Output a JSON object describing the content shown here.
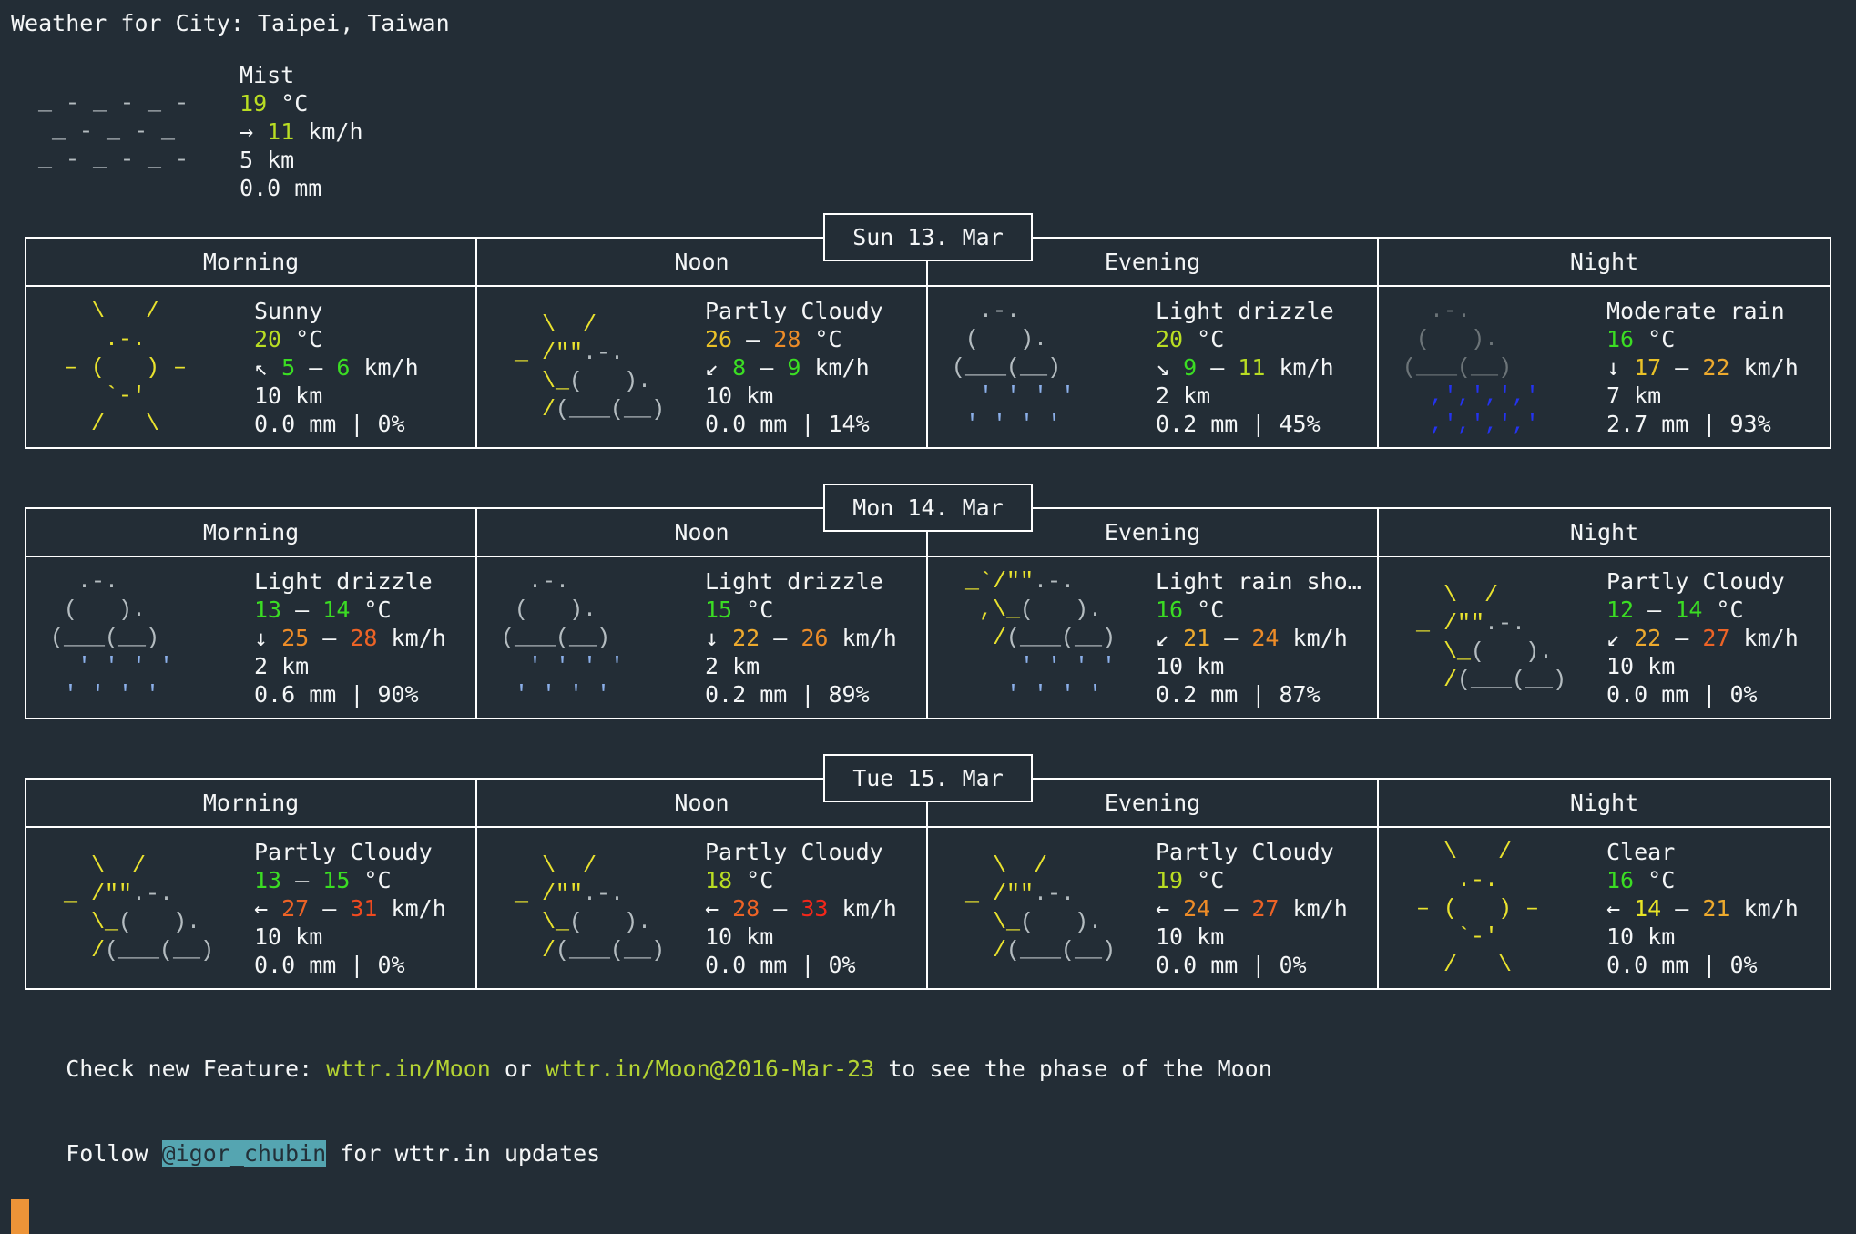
{
  "palette": {
    "w": "#f4f6f7",
    "grn": "#3bdd23",
    "ygr": "#b9dd23",
    "yel": "#e8e426",
    "gld": "#eac228",
    "org": "#edaa2e",
    "or2": "#ed8c28",
    "dor": "#ed6326",
    "ror": "#ef4a20",
    "red": "#f2271a",
    "gray": "#b4bcc0",
    "dgray": "#6c7478",
    "lblu": "#8cb0ea",
    "blu": "#2433f0",
    "sun": "#e9e22e",
    "lnk": "#b4d333",
    "hl_bg": "#55a5b1",
    "hl_fg": "#233038",
    "cursor": "#ed9438",
    "background": "#232d36",
    "border": "#ffffff"
  },
  "icons": {
    "mist": [
      [
        [
          "gray",
          "_ - _ - _ -"
        ]
      ],
      [
        [
          "gray",
          " _ - _ - _"
        ]
      ],
      [
        [
          "gray",
          "_ - _ - _ -"
        ]
      ]
    ],
    "sunny": [
      [
        [
          "sun",
          "   \\   /"
        ]
      ],
      [
        [
          "sun",
          "    .-."
        ]
      ],
      [
        [
          "sun",
          " ‒ (   ) ‒"
        ]
      ],
      [
        [
          "sun",
          "    `-'"
        ]
      ],
      [
        [
          "sun",
          "   /   \\"
        ]
      ]
    ],
    "clear": [
      [
        [
          "sun",
          "   \\   /"
        ]
      ],
      [
        [
          "sun",
          "    .-."
        ]
      ],
      [
        [
          "sun",
          " ‒ (   ) ‒"
        ]
      ],
      [
        [
          "sun",
          "    `-'"
        ]
      ],
      [
        [
          "sun",
          "   /   \\"
        ]
      ]
    ],
    "partly_cloudy": [
      [
        [
          "sun",
          "   \\  /"
        ]
      ],
      [
        [
          "sun",
          " _ /\"\""
        ],
        [
          "gray",
          ".-."
        ]
      ],
      [
        [
          "sun",
          "   \\_"
        ],
        [
          "gray",
          "(   )."
        ]
      ],
      [
        [
          "sun",
          "   /"
        ],
        [
          "gray",
          "(___(__)"
        ]
      ]
    ],
    "light_drizzle": [
      [
        [
          "gray",
          "  .-."
        ]
      ],
      [
        [
          "gray",
          " (   )."
        ]
      ],
      [
        [
          "gray",
          "(___(__)"
        ]
      ],
      [
        [
          "lblu",
          "  ' ' ' '"
        ]
      ],
      [
        [
          "lblu",
          " ' ' ' '"
        ]
      ]
    ],
    "moderate_rain": [
      [
        [
          "dgray",
          "  .-."
        ]
      ],
      [
        [
          "dgray",
          " (   )."
        ]
      ],
      [
        [
          "dgray",
          "(___(__)"
        ]
      ],
      [
        [
          "blu",
          "  ,',',','"
        ]
      ],
      [
        [
          "blu",
          "  ,',',','"
        ]
      ]
    ],
    "light_rain_shower": [
      [
        [
          "sun",
          " _`/\"\""
        ],
        [
          "gray",
          ".-."
        ]
      ],
      [
        [
          "sun",
          "  ,\\_"
        ],
        [
          "gray",
          "(   )."
        ]
      ],
      [
        [
          "sun",
          "   /"
        ],
        [
          "gray",
          "(___(__)"
        ]
      ],
      [
        [
          "lblu",
          "     ' ' ' '"
        ]
      ],
      [
        [
          "lblu",
          "    ' ' ' '"
        ]
      ]
    ]
  },
  "header": {
    "title": "Weather for City: Taipei, Taiwan"
  },
  "current": {
    "icon": "mist",
    "lines": [
      [
        [
          "w",
          "Mist"
        ]
      ],
      [
        [
          "ygr",
          "19"
        ],
        [
          "w",
          " °C"
        ]
      ],
      [
        [
          "w",
          "→ "
        ],
        [
          "ygr",
          "11"
        ],
        [
          "w",
          " km/h"
        ]
      ],
      [
        [
          "w",
          "5 km"
        ]
      ],
      [
        [
          "w",
          "0.0 mm"
        ]
      ]
    ]
  },
  "sections": [
    {
      "date": "Sun 13. Mar",
      "cols": [
        "Morning",
        "Noon",
        "Evening",
        "Night"
      ],
      "cells": [
        {
          "icon": "sunny",
          "desc": [
            [
              "w",
              "Sunny"
            ]
          ],
          "temp": [
            [
              "ygr",
              "20"
            ],
            [
              "w",
              " °C"
            ]
          ],
          "wind": [
            [
              "w",
              "↖ "
            ],
            [
              "grn",
              "5"
            ],
            [
              "w",
              " ‒ "
            ],
            [
              "grn",
              "6"
            ],
            [
              "w",
              " km/h"
            ]
          ],
          "vis": [
            [
              "w",
              "10 km"
            ]
          ],
          "precip": [
            [
              "w",
              "0.0 mm | 0%"
            ]
          ]
        },
        {
          "icon": "partly_cloudy",
          "desc": [
            [
              "w",
              "Partly Cloudy"
            ]
          ],
          "temp": [
            [
              "gld",
              "26"
            ],
            [
              "w",
              " ‒ "
            ],
            [
              "or2",
              "28"
            ],
            [
              "w",
              " °C"
            ]
          ],
          "wind": [
            [
              "w",
              "↙ "
            ],
            [
              "grn",
              "8"
            ],
            [
              "w",
              " ‒ "
            ],
            [
              "grn",
              "9"
            ],
            [
              "w",
              " km/h"
            ]
          ],
          "vis": [
            [
              "w",
              "10 km"
            ]
          ],
          "precip": [
            [
              "w",
              "0.0 mm | 14%"
            ]
          ]
        },
        {
          "icon": "light_drizzle",
          "desc": [
            [
              "w",
              "Light drizzle"
            ]
          ],
          "temp": [
            [
              "ygr",
              "20"
            ],
            [
              "w",
              " °C"
            ]
          ],
          "wind": [
            [
              "w",
              "↘ "
            ],
            [
              "grn",
              "9"
            ],
            [
              "w",
              " ‒ "
            ],
            [
              "ygr",
              "11"
            ],
            [
              "w",
              " km/h"
            ]
          ],
          "vis": [
            [
              "w",
              "2 km"
            ]
          ],
          "precip": [
            [
              "w",
              "0.2 mm | 45%"
            ]
          ]
        },
        {
          "icon": "moderate_rain",
          "desc": [
            [
              "w",
              "Moderate rain"
            ]
          ],
          "temp": [
            [
              "grn",
              "16"
            ],
            [
              "w",
              " °C"
            ]
          ],
          "wind": [
            [
              "w",
              "↓ "
            ],
            [
              "gld",
              "17"
            ],
            [
              "w",
              " ‒ "
            ],
            [
              "org",
              "22"
            ],
            [
              "w",
              " km/h"
            ]
          ],
          "vis": [
            [
              "w",
              "7 km"
            ]
          ],
          "precip": [
            [
              "w",
              "2.7 mm | 93%"
            ]
          ]
        }
      ]
    },
    {
      "date": "Mon 14. Mar",
      "cols": [
        "Morning",
        "Noon",
        "Evening",
        "Night"
      ],
      "cells": [
        {
          "icon": "light_drizzle",
          "desc": [
            [
              "w",
              "Light drizzle"
            ]
          ],
          "temp": [
            [
              "grn",
              "13"
            ],
            [
              "w",
              " ‒ "
            ],
            [
              "grn",
              "14"
            ],
            [
              "w",
              " °C"
            ]
          ],
          "wind": [
            [
              "w",
              "↓ "
            ],
            [
              "or2",
              "25"
            ],
            [
              "w",
              " ‒ "
            ],
            [
              "dor",
              "28"
            ],
            [
              "w",
              " km/h"
            ]
          ],
          "vis": [
            [
              "w",
              "2 km"
            ]
          ],
          "precip": [
            [
              "w",
              "0.6 mm | 90%"
            ]
          ]
        },
        {
          "icon": "light_drizzle",
          "desc": [
            [
              "w",
              "Light drizzle"
            ]
          ],
          "temp": [
            [
              "grn",
              "15"
            ],
            [
              "w",
              " °C"
            ]
          ],
          "wind": [
            [
              "w",
              "↓ "
            ],
            [
              "org",
              "22"
            ],
            [
              "w",
              " ‒ "
            ],
            [
              "or2",
              "26"
            ],
            [
              "w",
              " km/h"
            ]
          ],
          "vis": [
            [
              "w",
              "2 km"
            ]
          ],
          "precip": [
            [
              "w",
              "0.2 mm | 89%"
            ]
          ]
        },
        {
          "icon": "light_rain_shower",
          "desc": [
            [
              "w",
              "Light rain sho…"
            ]
          ],
          "temp": [
            [
              "grn",
              "16"
            ],
            [
              "w",
              " °C"
            ]
          ],
          "wind": [
            [
              "w",
              "↙ "
            ],
            [
              "org",
              "21"
            ],
            [
              "w",
              " ‒ "
            ],
            [
              "or2",
              "24"
            ],
            [
              "w",
              " km/h"
            ]
          ],
          "vis": [
            [
              "w",
              "10 km"
            ]
          ],
          "precip": [
            [
              "w",
              "0.2 mm | 87%"
            ]
          ]
        },
        {
          "icon": "partly_cloudy",
          "desc": [
            [
              "w",
              "Partly Cloudy"
            ]
          ],
          "temp": [
            [
              "grn",
              "12"
            ],
            [
              "w",
              " ‒ "
            ],
            [
              "grn",
              "14"
            ],
            [
              "w",
              " °C"
            ]
          ],
          "wind": [
            [
              "w",
              "↙ "
            ],
            [
              "org",
              "22"
            ],
            [
              "w",
              " ‒ "
            ],
            [
              "dor",
              "27"
            ],
            [
              "w",
              " km/h"
            ]
          ],
          "vis": [
            [
              "w",
              "10 km"
            ]
          ],
          "precip": [
            [
              "w",
              "0.0 mm | 0%"
            ]
          ]
        }
      ]
    },
    {
      "date": "Tue 15. Mar",
      "cols": [
        "Morning",
        "Noon",
        "Evening",
        "Night"
      ],
      "cells": [
        {
          "icon": "partly_cloudy",
          "desc": [
            [
              "w",
              "Partly Cloudy"
            ]
          ],
          "temp": [
            [
              "grn",
              "13"
            ],
            [
              "w",
              " ‒ "
            ],
            [
              "grn",
              "15"
            ],
            [
              "w",
              " °C"
            ]
          ],
          "wind": [
            [
              "w",
              "← "
            ],
            [
              "dor",
              "27"
            ],
            [
              "w",
              " ‒ "
            ],
            [
              "ror",
              "31"
            ],
            [
              "w",
              " km/h"
            ]
          ],
          "vis": [
            [
              "w",
              "10 km"
            ]
          ],
          "precip": [
            [
              "w",
              "0.0 mm | 0%"
            ]
          ]
        },
        {
          "icon": "partly_cloudy",
          "desc": [
            [
              "w",
              "Partly Cloudy"
            ]
          ],
          "temp": [
            [
              "ygr",
              "18"
            ],
            [
              "w",
              " °C"
            ]
          ],
          "wind": [
            [
              "w",
              "← "
            ],
            [
              "dor",
              "28"
            ],
            [
              "w",
              " ‒ "
            ],
            [
              "red",
              "33"
            ],
            [
              "w",
              " km/h"
            ]
          ],
          "vis": [
            [
              "w",
              "10 km"
            ]
          ],
          "precip": [
            [
              "w",
              "0.0 mm | 0%"
            ]
          ]
        },
        {
          "icon": "partly_cloudy",
          "desc": [
            [
              "w",
              "Partly Cloudy"
            ]
          ],
          "temp": [
            [
              "ygr",
              "19"
            ],
            [
              "w",
              " °C"
            ]
          ],
          "wind": [
            [
              "w",
              "← "
            ],
            [
              "or2",
              "24"
            ],
            [
              "w",
              " ‒ "
            ],
            [
              "dor",
              "27"
            ],
            [
              "w",
              " km/h"
            ]
          ],
          "vis": [
            [
              "w",
              "10 km"
            ]
          ],
          "precip": [
            [
              "w",
              "0.0 mm | 0%"
            ]
          ]
        },
        {
          "icon": "clear",
          "desc": [
            [
              "w",
              "Clear"
            ]
          ],
          "temp": [
            [
              "grn",
              "16"
            ],
            [
              "w",
              " °C"
            ]
          ],
          "wind": [
            [
              "w",
              "← "
            ],
            [
              "yel",
              "14"
            ],
            [
              "w",
              " ‒ "
            ],
            [
              "org",
              "21"
            ],
            [
              "w",
              " km/h"
            ]
          ],
          "vis": [
            [
              "w",
              "10 km"
            ]
          ],
          "precip": [
            [
              "w",
              "0.0 mm | 0%"
            ]
          ]
        }
      ]
    }
  ],
  "footer": {
    "check_prefix": "Check new Feature: ",
    "moon_link": "wttr.in/Moon",
    "or_text": " or ",
    "moon_date_link": "wttr.in/Moon@2016-Mar-23",
    "check_suffix": " to see the phase of the Moon",
    "follow_prefix": "Follow ",
    "handle": "@igor_chubin",
    "follow_suffix": " for wttr.in updates"
  }
}
